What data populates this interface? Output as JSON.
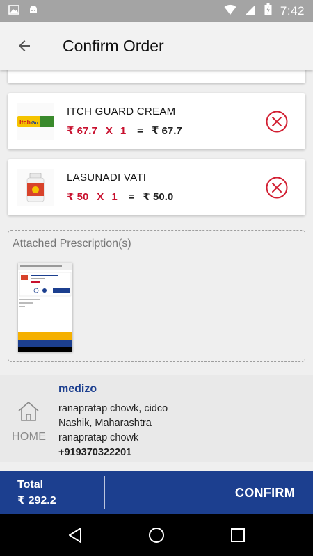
{
  "status_bar": {
    "time": "7:42"
  },
  "toolbar": {
    "title": "Confirm Order"
  },
  "items": [
    {
      "name": "ITCH GUARD CREAM",
      "price": "₹ 67.7",
      "x": "X",
      "qty": "1",
      "eq": "=",
      "total": "₹ 67.7"
    },
    {
      "name": "LASUNADI VATI",
      "price": "₹ 50",
      "x": "X",
      "qty": "1",
      "eq": "=",
      "total": "₹ 50.0"
    }
  ],
  "prescription": {
    "title": "Attached Prescription(s)"
  },
  "address": {
    "label": "HOME",
    "name": "medizo",
    "line1": "ranapratap chowk, cidco",
    "line2": "Nashik, Maharashtra",
    "line3": "ranapratap chowk",
    "phone": "+919370322201"
  },
  "bottom": {
    "total_label": "Total",
    "total_value": "₹ 292.2",
    "confirm_label": "CONFIRM"
  },
  "colors": {
    "brand": "#1c3f8f",
    "price_red": "#c8102e",
    "remove_red": "#d21f32"
  }
}
